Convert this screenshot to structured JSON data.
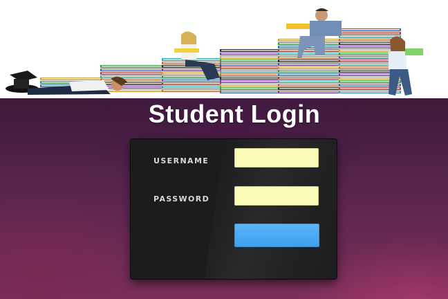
{
  "page": {
    "title": "Student Login"
  },
  "hero": {
    "icon": "students-on-book-stairs-illustration"
  },
  "login_form": {
    "username_label": "USERNAME",
    "username_value": "",
    "password_label": "PASSWORD",
    "password_value": "",
    "submit_label": ""
  },
  "colors": {
    "input_background": "#fbfbb8",
    "button_blue": "#4aa8f2",
    "card_background": "#1c1c1e",
    "backdrop_purple": "#58244e"
  }
}
